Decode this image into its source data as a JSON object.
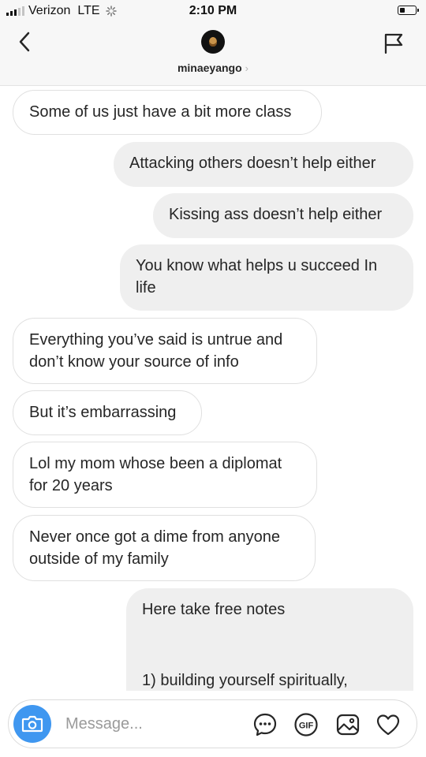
{
  "status_bar": {
    "carrier": "Verizon",
    "network": "LTE",
    "time": "2:10 PM",
    "battery_level": 0.25
  },
  "header": {
    "username": "minaeyango",
    "username_chevron": "›"
  },
  "messages": [
    {
      "direction": "incoming",
      "text": "Some of us just have a bit more class"
    },
    {
      "direction": "outgoing",
      "text": "Attacking others doesn’t help either"
    },
    {
      "direction": "outgoing",
      "text": "Kissing ass doesn’t help either"
    },
    {
      "direction": "outgoing",
      "text": "You know what helps u succeed In life"
    },
    {
      "direction": "incoming",
      "text": "Everything you’ve said is untrue and don’t know your source of info"
    },
    {
      "direction": "incoming",
      "text": "But it’s embarrassing"
    },
    {
      "direction": "incoming",
      "text": "Lol my mom whose been a diplomat for 20 years"
    },
    {
      "direction": "incoming",
      "text": "Never once got a dime from anyone outside of my family"
    },
    {
      "direction": "outgoing",
      "text": "Here take free notes",
      "text_continued": "1) building yourself spiritually,"
    }
  ],
  "composer": {
    "placeholder": "Message...",
    "icons": [
      "camera-icon",
      "more-options-icon",
      "gif-icon",
      "gallery-icon",
      "heart-icon"
    ],
    "gif_label": "GIF"
  },
  "colors": {
    "camera_button": "#3f97f0",
    "outgoing_bubble": "#efefef",
    "incoming_border": "#e0e0e0"
  }
}
